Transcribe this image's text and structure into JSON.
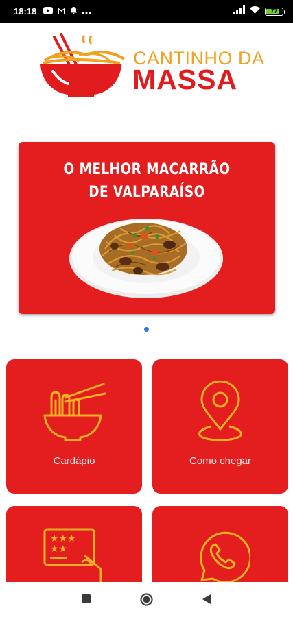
{
  "status_bar": {
    "time": "18:18",
    "battery_percent": "77"
  },
  "logo": {
    "line1": "CANTINHO DA",
    "line2": "MASSA"
  },
  "banner": {
    "headline_line1": "O MELHOR MACARRÃO",
    "headline_line2": "DE VALPARAÍSO",
    "carousel_page": 1
  },
  "tiles": [
    {
      "label": "Cardápio",
      "icon": "noodle-bowl-icon"
    },
    {
      "label": "Como chegar",
      "icon": "location-pin-icon"
    },
    {
      "label": "",
      "icon": "rating-card-icon"
    },
    {
      "label": "",
      "icon": "phone-icon"
    }
  ],
  "colors": {
    "brand_red": "#e41e1e",
    "brand_orange": "#f0a11f",
    "icon_gold": "#f5b324",
    "indicator_blue": "#2f76e8"
  },
  "navigation": {
    "buttons": [
      "recents-icon",
      "home-icon",
      "back-icon"
    ]
  }
}
